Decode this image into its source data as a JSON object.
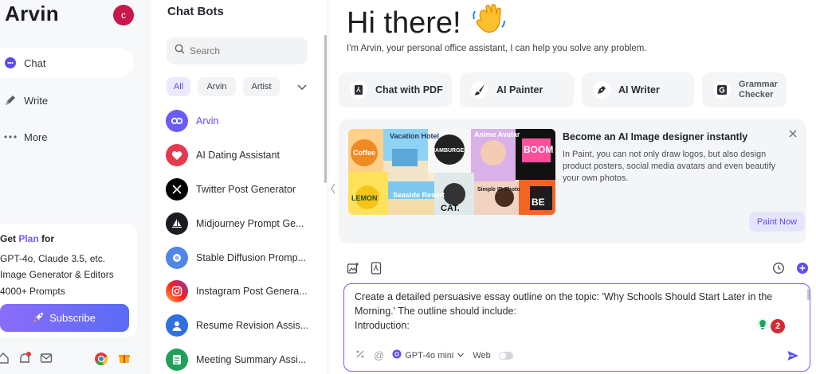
{
  "nav": {
    "brand": "Arvin",
    "avatar_initial": "c",
    "items": [
      {
        "label": "Chat",
        "icon": "chat-icon"
      },
      {
        "label": "Write",
        "icon": "pen-icon"
      },
      {
        "label": "More",
        "icon": "more-dots-icon"
      }
    ],
    "promo": {
      "prefix": "Get ",
      "plan": "Plan",
      "suffix": " for",
      "lines": [
        "GPT-4o, Claude 3.5, etc.",
        "Image Generator & Editors",
        "4000+ Prompts"
      ],
      "subscribe": "Subscribe"
    },
    "bottom_icons": [
      "home-icon",
      "bell-icon",
      "mail-icon",
      "chrome-icon",
      "gift-icon"
    ]
  },
  "bots": {
    "title": "Chat Bots",
    "search_placeholder": "Search",
    "chips": [
      "All",
      "Arvin",
      "Artist"
    ],
    "items": [
      {
        "name": "Arvin",
        "icon": "arvin-logo"
      },
      {
        "name": "AI Dating Assistant",
        "icon": "heart-icon"
      },
      {
        "name": "Twitter Post Generator",
        "icon": "x-logo"
      },
      {
        "name": "Midjourney Prompt Ge...",
        "icon": "sailboat-icon"
      },
      {
        "name": "Stable Diffusion Promp...",
        "icon": "stable-diffusion-icon"
      },
      {
        "name": "Instagram Post Genera...",
        "icon": "instagram-logo"
      },
      {
        "name": "Resume Revision Assis...",
        "icon": "person-icon"
      },
      {
        "name": "Meeting Summary Assi...",
        "icon": "document-icon"
      }
    ]
  },
  "main": {
    "greeting": "Hi there!",
    "subtitle": "I'm Arvin, your personal office assistant, I can help you solve any problem.",
    "tools": [
      {
        "label": "Chat with PDF",
        "icon": "pdf-icon"
      },
      {
        "label": "AI Painter",
        "icon": "brush-icon"
      },
      {
        "label": "AI Writer",
        "icon": "pen-nib-icon"
      },
      {
        "label": "Grammar Checker",
        "icon": "grammarly-icon"
      }
    ],
    "banner": {
      "title": "Become an AI Image designer instantly",
      "description": "In Paint, you can not only draw logos, but also design product posters, social media avatars and even beautify your own photos.",
      "button": "Paint Now",
      "image_labels": [
        "Coffee",
        "Vacation Hotel",
        "HAMBURGER",
        "Anime Avatar",
        "BOOM",
        "LEMON",
        "Seaside Resort",
        "CAT.",
        "Simple ID Photo",
        "BE"
      ]
    },
    "composer": {
      "lines": [
        "Create a detailed persuasive essay outline on the topic: 'Why Schools Should Start Later in the",
        "Morning.' The outline should include:",
        "Introduction:"
      ],
      "badge_count": "2",
      "model": "GPT-4o mini",
      "web_label": "Web"
    }
  }
}
